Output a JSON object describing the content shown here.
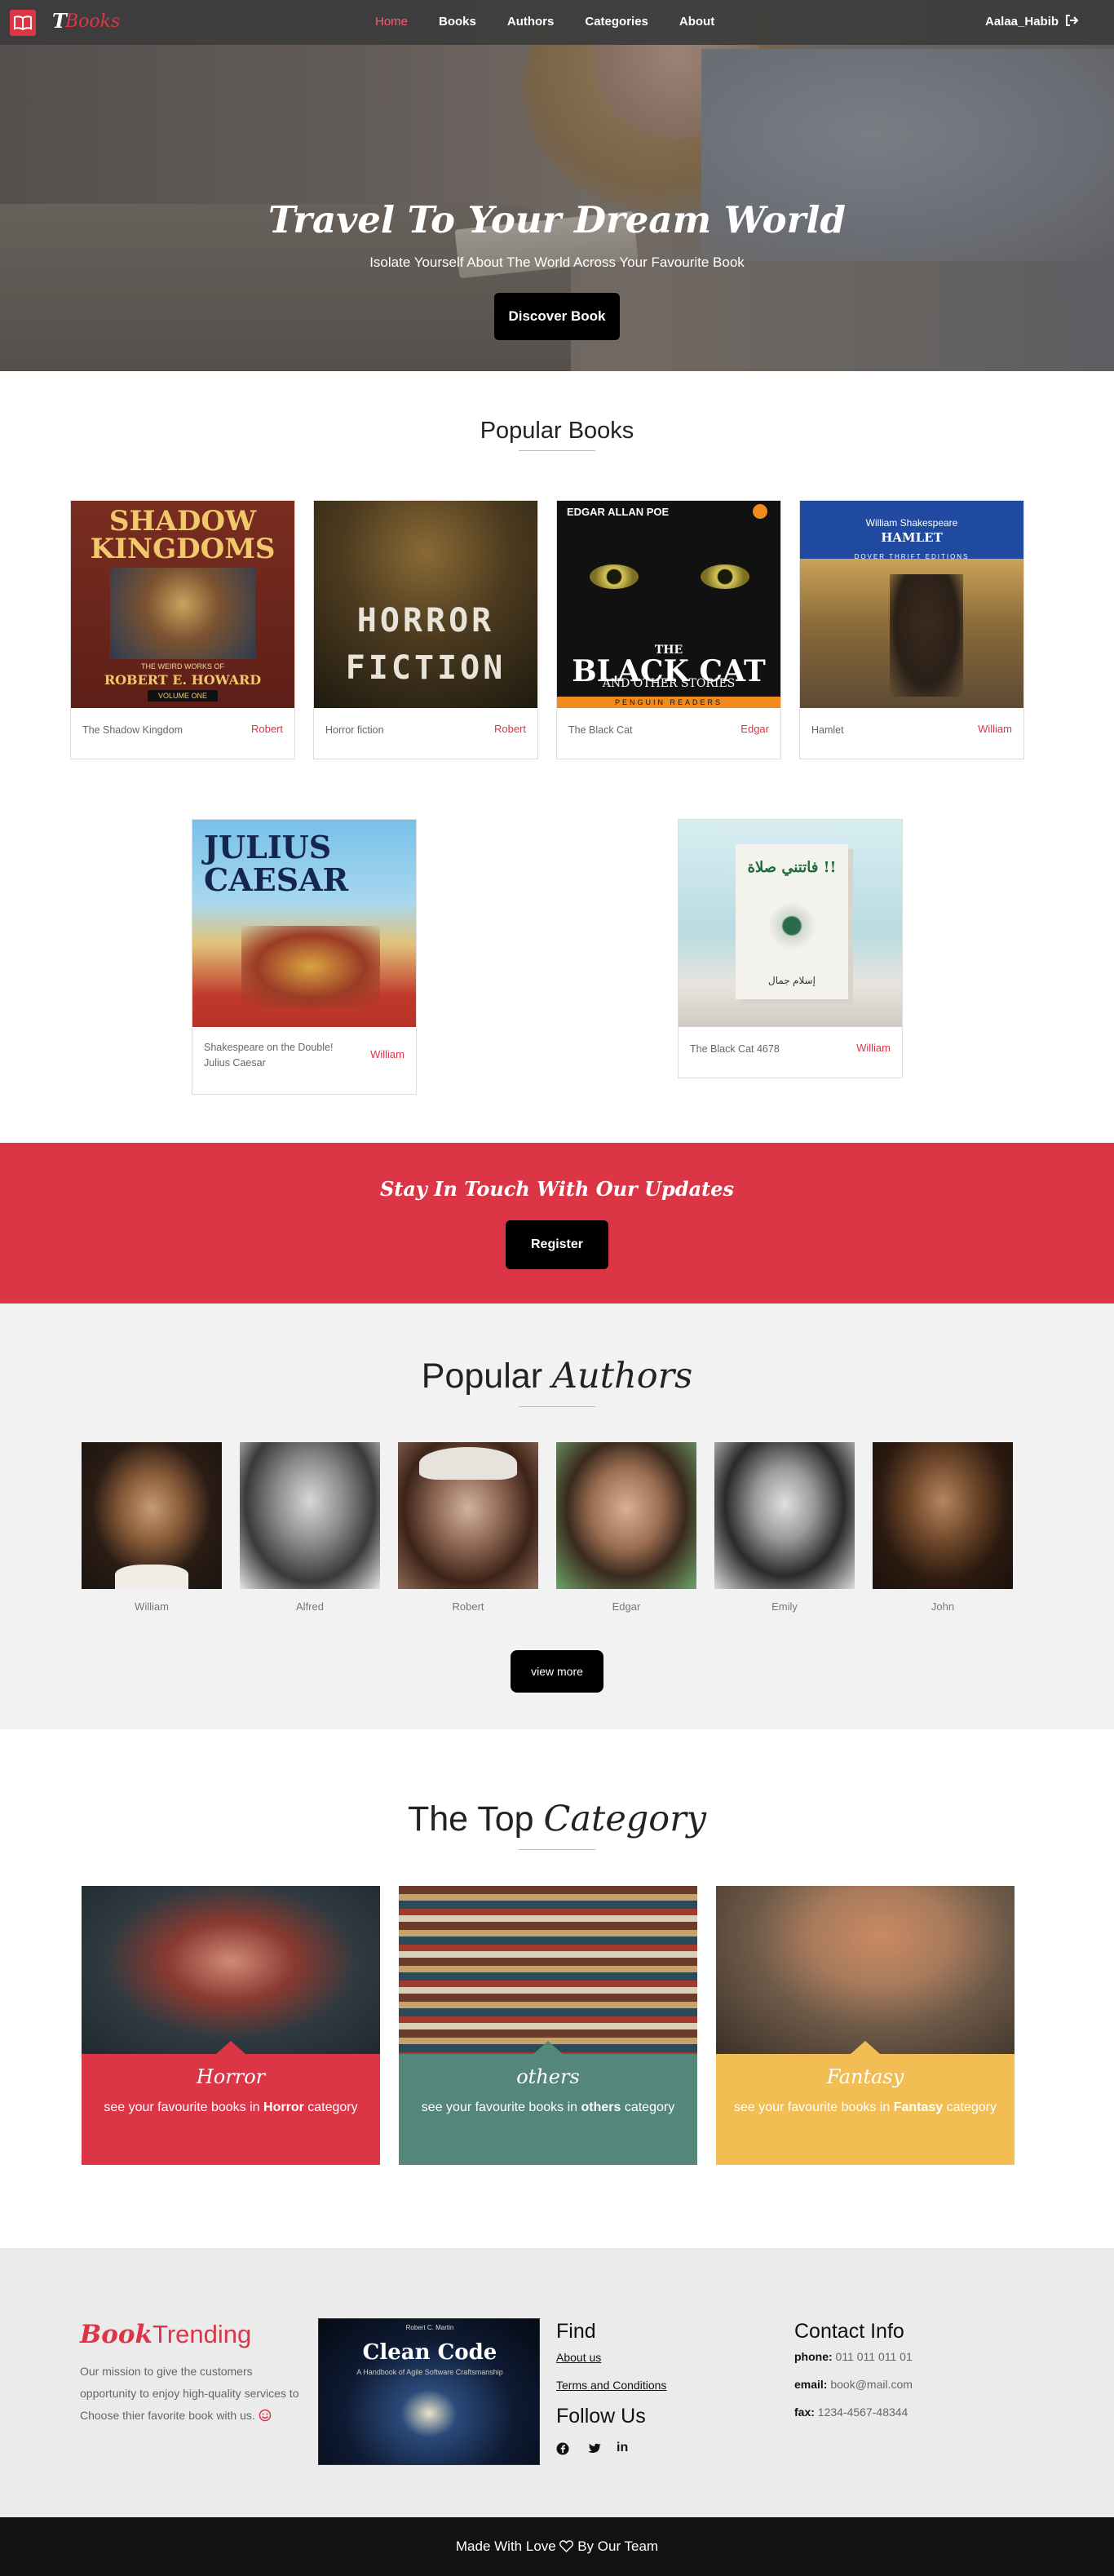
{
  "nav": {
    "brand_t": "T",
    "brand_word": "Books",
    "links": [
      "Home",
      "Books",
      "Authors",
      "Categories",
      "About"
    ],
    "active": "Home",
    "user": "Aalaa_Habib"
  },
  "hero": {
    "title": "Travel To Your Dream World",
    "subtitle": "Isolate Yourself About The World Across Your Favourite Book",
    "button": "Discover Book"
  },
  "popular_books": {
    "title": "Popular Books",
    "books": [
      {
        "title": "The Shadow Kingdom",
        "author": "Robert",
        "cover_line1": "SHADOW",
        "cover_line2": "KINGDOMS",
        "cover_small": "THE WEIRD WORKS OF",
        "cover_author": "ROBERT E. HOWARD",
        "cover_vol": "VOLUME ONE"
      },
      {
        "title": "Horror fiction",
        "author": "Robert",
        "cover_line1": "HORROR",
        "cover_line2": "FICTION"
      },
      {
        "title": "The Black Cat",
        "author": "Edgar",
        "cover_top": "EDGAR ALLAN POE",
        "cover_line1": "THE",
        "cover_line2": "BLACK CAT",
        "cover_small": "AND OTHER STORIES",
        "cover_bottom": "PENGUIN READERS"
      },
      {
        "title": "Hamlet",
        "author": "William",
        "cover_top": "William Shakespeare",
        "cover_line1": "HAMLET",
        "cover_small": "DOVER THRIFT EDITIONS"
      },
      {
        "title_line1": "Shakespeare on the Double!",
        "title_line2": "Julius Caesar",
        "author": "William",
        "cover_line1": "JULIUS",
        "cover_line2": "CAESAR"
      },
      {
        "title": "The Black Cat 4678",
        "author": "William",
        "cover_line1": "فاتتني صلاة !!",
        "cover_small": "إسلام جمال"
      }
    ]
  },
  "updates": {
    "title": "Stay In Touch With Our Updates",
    "button": "Register"
  },
  "popular_authors": {
    "title_plain": "Popular",
    "title_italic": "Authors",
    "authors": [
      "William",
      "Alfred",
      "Robert",
      "Edgar",
      "Emily",
      "John"
    ],
    "button": "view more"
  },
  "top_category": {
    "title_plain": "The Top",
    "title_italic": "Category",
    "categories": [
      {
        "name": "Horror",
        "desc_pre": "see your favourite books in",
        "desc_bold": "Horror",
        "desc_post": "category",
        "color": "#dc3545"
      },
      {
        "name": "others",
        "desc_pre": "see your favourite books in",
        "desc_bold": "others",
        "desc_post": "category",
        "color": "#54877a"
      },
      {
        "name": "Fantasy",
        "desc_pre": "see your favourite books in",
        "desc_bold": "Fantasy",
        "desc_post": "category",
        "color": "#f2bd52"
      }
    ]
  },
  "footer": {
    "brand_italic": "Book",
    "brand_plain": "Trending",
    "mission": "Our mission to give the customers opportunity to enjoy high-quality services to Choose thier favorite book with us.",
    "promo_book": {
      "title": "Clean Code",
      "subtitle": "A Handbook of Agile Software Craftsmanship",
      "author": "Robert C. Martin"
    },
    "find_title": "Find",
    "find_links": [
      "About us",
      "Terms and Conditions"
    ],
    "follow_title": "Follow Us",
    "contact_title": "Contact Info",
    "phone_label": "phone:",
    "phone": "011 011 011 01",
    "email_label": "email:",
    "email": "book@mail.com",
    "fax_label": "fax:",
    "fax": "1234-4567-48344"
  },
  "bottom_bar": {
    "pre": "Made With Love",
    "post": "By Our Team"
  },
  "colors": {
    "accent": "#dc3545",
    "dark": "#000000",
    "footer_bg": "#ebebeb",
    "authors_bg": "#f2f2f2"
  }
}
